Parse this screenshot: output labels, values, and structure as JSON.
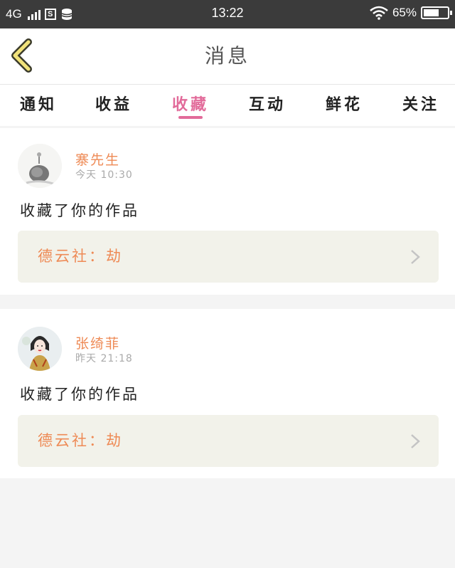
{
  "status_bar": {
    "network": "4G",
    "time": "13:22",
    "battery_text": "65%",
    "battery_level": 0.65,
    "sim_icon_text": "S"
  },
  "header": {
    "title": "消息",
    "back_icon": "chevron-left-icon"
  },
  "tabs": [
    {
      "label": "通知",
      "active": false
    },
    {
      "label": "收益",
      "active": false
    },
    {
      "label": "收藏",
      "active": true
    },
    {
      "label": "互动",
      "active": false
    },
    {
      "label": "鲜花",
      "active": false
    },
    {
      "label": "关注",
      "active": false
    }
  ],
  "colors": {
    "accent": "#e26b9a",
    "name": "#ee8a55",
    "work_bg": "#f2f2ea",
    "page_bg": "#f4f4f4"
  },
  "messages": [
    {
      "user_name": "寨先生",
      "time": "今天 10:30",
      "text": "收藏了你的作品",
      "work_title": "德云社：劫",
      "avatar": "ink-painting-avatar"
    },
    {
      "user_name": "张绮菲",
      "time": "昨天 21:18",
      "text": "收藏了你的作品",
      "work_title": "德云社：劫",
      "avatar": "illustrated-woman-avatar"
    }
  ]
}
